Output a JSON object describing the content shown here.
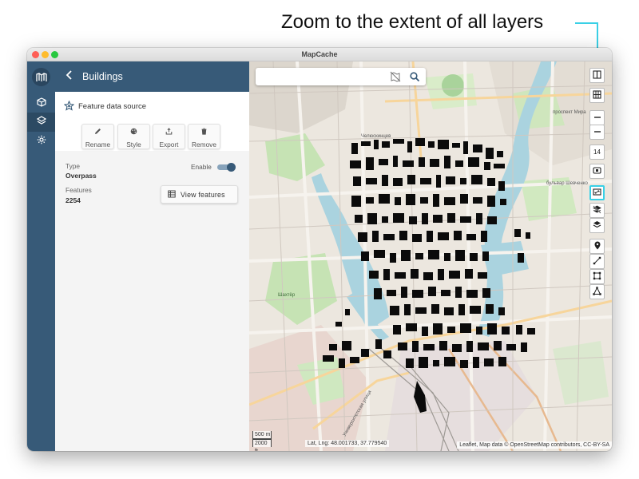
{
  "annotation": {
    "text": "Zoom to the extent of all layers",
    "color": "#3ad0e6"
  },
  "window": {
    "title": "MapCache"
  },
  "rail": {
    "items": [
      {
        "name": "nav-projects",
        "icon": "cube-icon"
      },
      {
        "name": "nav-layers",
        "icon": "layers-icon"
      },
      {
        "name": "nav-settings",
        "icon": "gear-icon"
      }
    ]
  },
  "panel": {
    "title": "Buildings",
    "source_title": "Feature data source",
    "actions": {
      "rename": "Rename",
      "style": "Style",
      "export": "Export",
      "remove": "Remove"
    },
    "type_label": "Type",
    "type_value": "Overpass",
    "enable_label": "Enable",
    "enabled": true,
    "features_label": "Features",
    "features_value": "2254",
    "view_features": "View features"
  },
  "map": {
    "search_placeholder": "",
    "tools": [
      {
        "name": "split-view-tool",
        "icon": "columns-icon"
      },
      {
        "name": "grid-tool",
        "icon": "grid-icon"
      },
      {
        "name": "zoom-in-tool",
        "icon": "plus-icon"
      },
      {
        "name": "zoom-out-tool",
        "icon": "minus-icon"
      },
      {
        "name": "zoom-level-tool",
        "label": "14"
      },
      {
        "name": "fit-tool",
        "icon": "fit-icon"
      },
      {
        "name": "zoom-to-extent-tool",
        "icon": "extent-icon"
      },
      {
        "name": "layers-off-tool",
        "icon": "layers-off-icon"
      },
      {
        "name": "layers-tool",
        "icon": "layers-icon"
      },
      {
        "name": "marker-tool",
        "icon": "marker-icon"
      },
      {
        "name": "polyline-tool",
        "icon": "polyline-icon"
      },
      {
        "name": "rectangle-tool",
        "icon": "rectangle-icon"
      },
      {
        "name": "polygon-tool",
        "icon": "polygon-icon"
      }
    ],
    "scale_metric": "500 m",
    "scale_imperial": "2000 ft",
    "coords": "Lat, Lng: 48.001733, 37.779540",
    "attribution": "Leaflet, Map data © OpenStreetMap contributors, CC-BY-SA",
    "street_labels": {
      "s1": "бульвар Шевченко",
      "s2": "проспект Мира",
      "s3": "Университетская улица",
      "s4": "Челюскинцев",
      "s5": "Шахтёр"
    }
  },
  "colors": {
    "rail": "#375a78",
    "accent": "#3ad0e6",
    "water": "#aad3df",
    "park": "#c8e6b0"
  }
}
